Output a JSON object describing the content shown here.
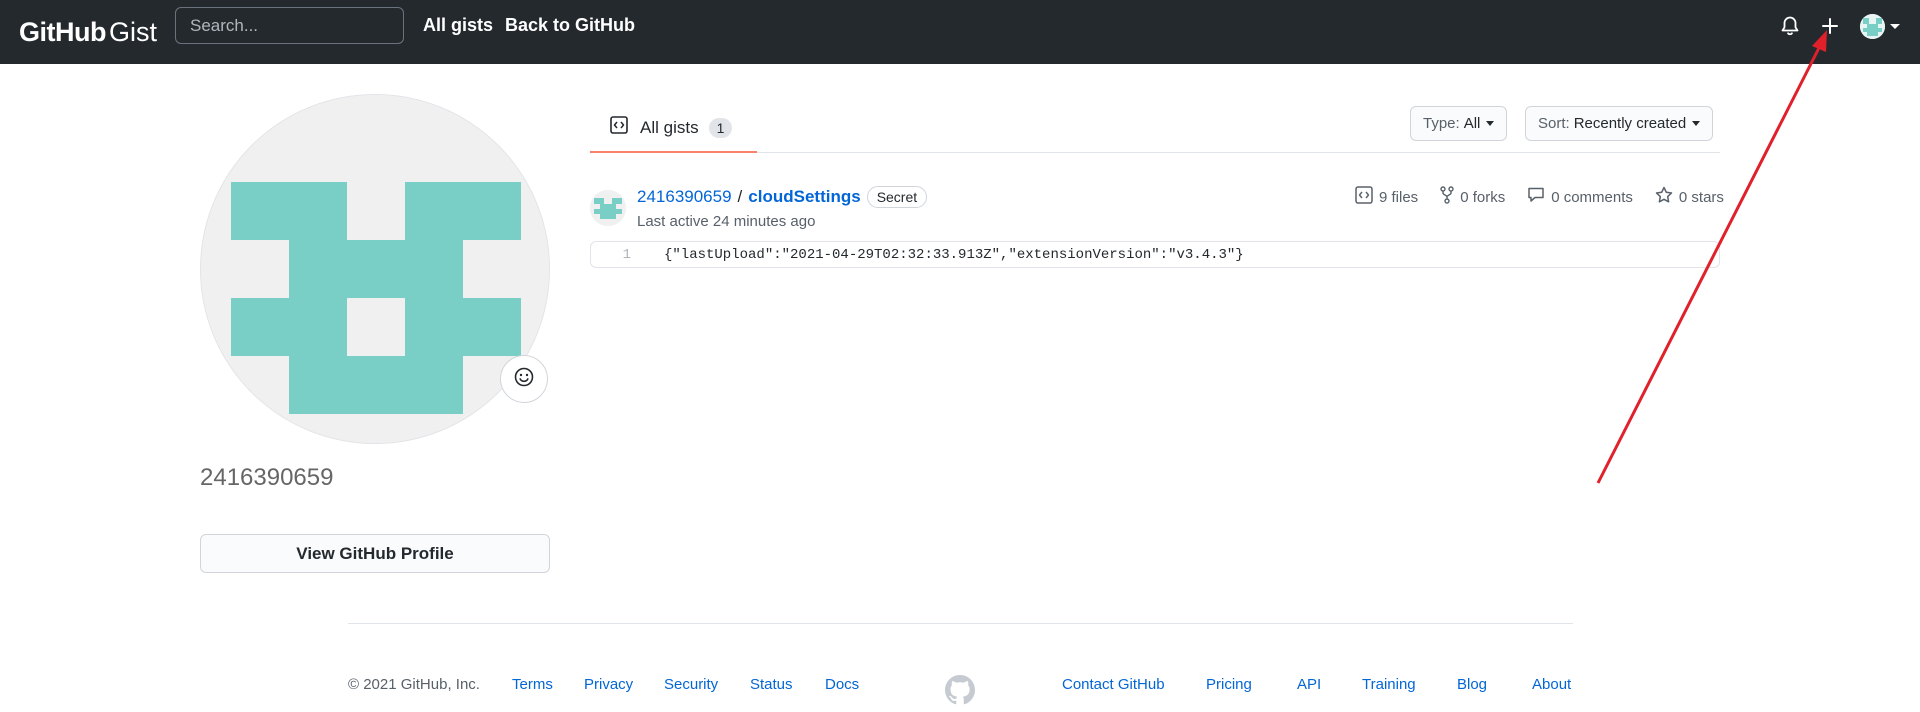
{
  "header": {
    "logo_github": "GitHub",
    "logo_gist": "Gist",
    "search_placeholder": "Search...",
    "nav_all_gists": "All gists",
    "nav_back": "Back to GitHub"
  },
  "profile": {
    "username": "2416390659",
    "view_profile_label": "View GitHub Profile"
  },
  "tabs": {
    "all_gists_label": "All gists",
    "all_gists_count": "1"
  },
  "filters": {
    "type_label": "Type:",
    "type_value": "All",
    "sort_label": "Sort:",
    "sort_value": "Recently created"
  },
  "gist": {
    "owner": "2416390659",
    "separator": "/",
    "name": "cloudSettings",
    "badge": "Secret",
    "last_active": "Last active 24 minutes ago",
    "files": "9 files",
    "forks": "0 forks",
    "comments": "0 comments",
    "stars": "0 stars",
    "line_number": "1",
    "code": "{\"lastUpload\":\"2021-04-29T02:32:33.913Z\",\"extensionVersion\":\"v3.4.3\"}"
  },
  "footer": {
    "copyright": "© 2021 GitHub, Inc.",
    "links": [
      "Terms",
      "Privacy",
      "Security",
      "Status",
      "Docs",
      "Contact GitHub",
      "Pricing",
      "API",
      "Training",
      "Blog",
      "About"
    ]
  },
  "colors": {
    "header_bg": "#24292e",
    "link": "#0366d6",
    "identicon": "#79cec6",
    "tab_underline": "#f9826c",
    "annotation_arrow": "#e0202a"
  },
  "icons": {
    "bell": "bell-icon",
    "plus": "plus-icon",
    "code": "code-square-icon",
    "fork": "fork-icon",
    "comment": "comment-icon",
    "star": "star-icon",
    "smiley": "smiley-icon",
    "octocat": "github-mark-icon"
  }
}
